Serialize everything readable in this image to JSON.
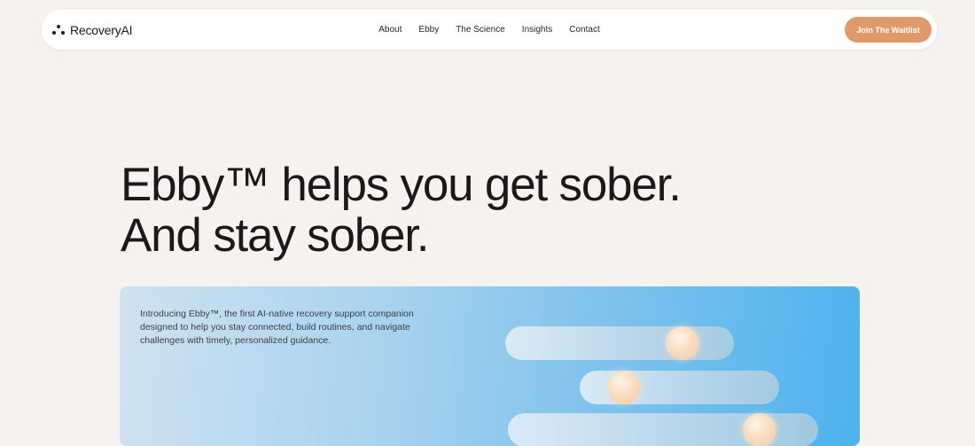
{
  "brand": {
    "name": "RecoveryAI",
    "icon": "three-dots-logo-icon"
  },
  "nav": {
    "links": [
      "About",
      "Ebby",
      "The Science",
      "Insights",
      "Contact"
    ],
    "cta_label": "Join The Waitlist"
  },
  "hero": {
    "title_line1": "Ebby™ helps you get sober.",
    "title_line2": "And stay sober.",
    "description": "Introducing Ebby™, the first AI-native recovery support companion designed to help you stay connected, build routines, and navigate challenges with timely, personalized guidance."
  },
  "colors": {
    "background": "#f5f2ef",
    "accent": "#e09a6a",
    "card_gradient_start": "#cfe2f0",
    "card_gradient_end": "#4db3ee"
  }
}
